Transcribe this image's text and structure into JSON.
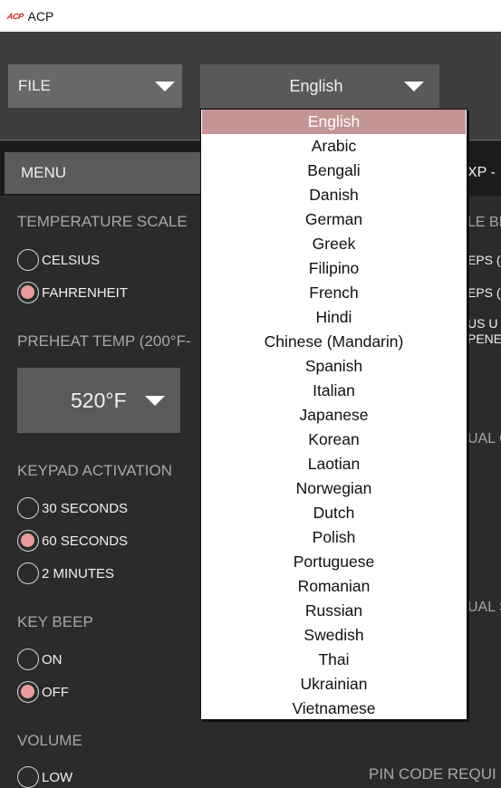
{
  "window": {
    "title": "ACP",
    "logo_text": "ACP"
  },
  "toolbar": {
    "file_dropdown": {
      "label": "FILE"
    },
    "language_dropdown": {
      "value": "English"
    }
  },
  "tabs": {
    "menu": "MENU",
    "right_partial": "XP -"
  },
  "settings": {
    "temperature_scale": {
      "label": "TEMPERATURE SCALE",
      "options": [
        {
          "label": "CELSIUS",
          "selected": false
        },
        {
          "label": "FAHRENHEIT",
          "selected": true
        }
      ]
    },
    "preheat_temp": {
      "label": "PREHEAT TEMP (200°F-",
      "value": "520°F"
    },
    "keypad_activation": {
      "label": "KEYPAD ACTIVATION",
      "options": [
        {
          "label": "30 SECONDS",
          "selected": false
        },
        {
          "label": "60 SECONDS",
          "selected": true
        },
        {
          "label": "2 MINUTES",
          "selected": false
        }
      ]
    },
    "key_beep": {
      "label": "KEY BEEP",
      "options": [
        {
          "label": "ON",
          "selected": false
        },
        {
          "label": "OFF",
          "selected": true
        }
      ]
    },
    "volume": {
      "label": "VOLUME",
      "options": [
        {
          "label": "LOW",
          "selected": false
        }
      ]
    }
  },
  "right_column_partial": {
    "label1": "LE BE",
    "item1": "EPS (",
    "item2": "EPS (",
    "item3_line1": "US U",
    "item3_line2": "PENE",
    "label2": "UAL C",
    "label3": "UAL S",
    "pin_label": "PIN CODE REQUI"
  },
  "language_popup": {
    "selected": "English",
    "options": [
      "English",
      "Arabic",
      "Bengali",
      "Danish",
      "German",
      "Greek",
      "Filipino",
      "French",
      "Hindi",
      "Chinese (Mandarin)",
      "Spanish",
      "Italian",
      "Japanese",
      "Korean",
      "Laotian",
      "Norwegian",
      "Dutch",
      "Polish",
      "Portuguese",
      "Romanian",
      "Russian",
      "Swedish",
      "Thai",
      "Ukrainian",
      "Vietnamese"
    ]
  },
  "colors": {
    "accent": "#e89c9c",
    "selection": "#c49595",
    "logo": "#d0202a"
  }
}
